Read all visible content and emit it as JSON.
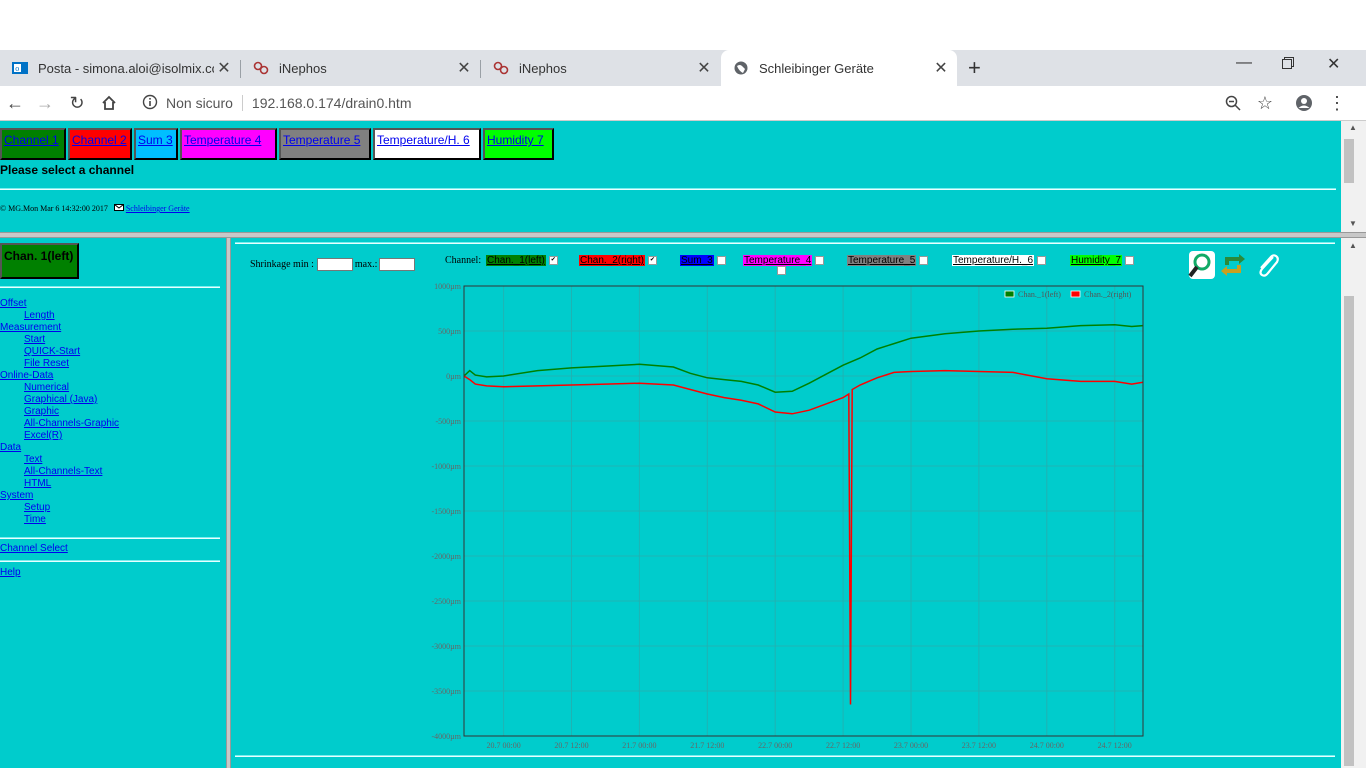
{
  "browser": {
    "tabs": [
      {
        "title": "Posta - simona.aloi@isolmix.com",
        "icon": "outlook-icon"
      },
      {
        "title": "iNephos",
        "icon": "inephos-icon"
      },
      {
        "title": "iNephos",
        "icon": "inephos-icon"
      },
      {
        "title": "Schleibinger Geräte",
        "icon": "globe-icon",
        "active": true
      }
    ],
    "security_label": "Non sicuro",
    "url": "192.168.0.174/drain0.htm"
  },
  "top": {
    "channels": [
      {
        "label": "Channel 1",
        "bg": "#008000",
        "fg": "#0000ee"
      },
      {
        "label": "Channel 2",
        "bg": "#ff0000",
        "fg": "#0000ee"
      },
      {
        "label": "Sum 3",
        "bg": "#00bfff",
        "fg": "#0000ee"
      },
      {
        "label": "Temperature 4",
        "bg": "#ff00ff",
        "fg": "#0000ee"
      },
      {
        "label": "Temperature 5",
        "bg": "#808080",
        "fg": "#0000ee"
      },
      {
        "label": "Temperature/H. 6",
        "bg": "#ffffff",
        "fg": "#0000ee"
      },
      {
        "label": "Humidity 7",
        "bg": "#00ff00",
        "fg": "#0000ee"
      }
    ],
    "prompt": "Please select a channel",
    "footer_text": "© MG.Mon Mar 6 14:32:00 2017",
    "footer_link": "Schleibinger Geräte"
  },
  "left": {
    "current_channel": "Chan. 1(left)",
    "menu": [
      {
        "label": "Offset",
        "level": 0
      },
      {
        "label": "Length",
        "level": 1
      },
      {
        "label": "Measurement",
        "level": 0
      },
      {
        "label": "Start",
        "level": 1
      },
      {
        "label": "QUICK-Start",
        "level": 1
      },
      {
        "label": "File Reset",
        "level": 1
      },
      {
        "label": "Online-Data",
        "level": 0
      },
      {
        "label": "Numerical",
        "level": 1
      },
      {
        "label": "Graphical (Java)",
        "level": 1
      },
      {
        "label": "Graphic",
        "level": 1
      },
      {
        "label": "All-Channels-Graphic",
        "level": 1
      },
      {
        "label": "Excel(R)",
        "level": 1
      },
      {
        "label": "Data",
        "level": 0
      },
      {
        "label": "Text",
        "level": 1
      },
      {
        "label": "All-Channels-Text",
        "level": 1
      },
      {
        "label": "HTML",
        "level": 1
      },
      {
        "label": "System",
        "level": 0
      },
      {
        "label": "Setup",
        "level": 1
      },
      {
        "label": "Time",
        "level": 1
      }
    ],
    "channel_select": "Channel Select",
    "help": "Help"
  },
  "main": {
    "shrinkage_min_label": "Shrinkage min :",
    "shrinkage_max_label": "max.:",
    "shrinkage_min_value": "",
    "shrinkage_max_value": "",
    "channel_label": "Channel:",
    "channel_checks": [
      {
        "label": "Chan._1(left)",
        "bg": "#008000",
        "fg": "#000000",
        "checked": true
      },
      {
        "label": "Chan._2(right)",
        "bg": "#ff0000",
        "fg": "#000000",
        "checked": true
      },
      {
        "label": "Sum_3",
        "bg": "#0000ff",
        "fg": "#000000",
        "checked": false
      },
      {
        "label": "Temperature_4",
        "bg": "#ff00ff",
        "fg": "#000000",
        "checked": false
      },
      {
        "label": "Temperature_5",
        "bg": "#808080",
        "fg": "#000000",
        "checked": false
      },
      {
        "label": "Temperature/H._6",
        "bg": "#ffffff",
        "fg": "#000000",
        "checked": false
      },
      {
        "label": "Humidity_7",
        "bg": "#00ff00",
        "fg": "#000000",
        "checked": false
      }
    ]
  },
  "chart_data": {
    "type": "line",
    "ylim": [
      -4000,
      1000
    ],
    "y_ticks": [
      1000,
      500,
      0,
      -500,
      -1000,
      -1500,
      -2000,
      -2500,
      -3000,
      -3500,
      -4000
    ],
    "y_tick_labels": [
      "1000µm",
      "500µm",
      "0µm",
      "-500µm",
      "-1000µm",
      "-1500µm",
      "-2000µm",
      "-2500µm",
      "-3000µm",
      "-3500µm",
      "-4000µm"
    ],
    "x_tick_labels": [
      "20.7 00:00",
      "20.7 12:00",
      "21.7 00:00",
      "21.7 12:00",
      "22.7 00:00",
      "22.7 12:00",
      "23.7 00:00",
      "23.7 12:00",
      "24.7 00:00",
      "24.7 12:00"
    ],
    "xlim_hours": [
      -7,
      113
    ],
    "grid": true,
    "legend_position": "top-right",
    "series": [
      {
        "name": "Chan._1(left)",
        "color": "#008000",
        "x_hours": [
          -7,
          -6,
          -5,
          -3,
          0,
          6,
          12,
          18,
          24,
          30,
          33,
          36,
          39,
          42,
          45,
          48,
          51,
          54,
          57,
          60,
          63,
          66,
          69,
          72,
          78,
          84,
          90,
          96,
          102,
          108,
          111,
          113
        ],
        "y": [
          0,
          60,
          10,
          -10,
          0,
          60,
          90,
          110,
          130,
          100,
          30,
          -20,
          -40,
          -60,
          -100,
          -180,
          -170,
          -80,
          20,
          120,
          200,
          300,
          360,
          420,
          470,
          500,
          520,
          530,
          560,
          570,
          550,
          560
        ]
      },
      {
        "name": "Chan._2(right)",
        "color": "#ff0000",
        "x_hours": [
          -7,
          -6,
          -5,
          -3,
          0,
          6,
          12,
          18,
          24,
          30,
          33,
          36,
          39,
          42,
          45,
          48,
          51,
          54,
          57,
          60,
          61,
          61.3,
          61.6,
          63,
          66,
          69,
          72,
          78,
          84,
          90,
          96,
          102,
          108,
          111,
          113
        ],
        "y": [
          0,
          -40,
          -90,
          -110,
          -120,
          -110,
          -100,
          -90,
          -80,
          -100,
          -150,
          -200,
          -240,
          -270,
          -310,
          -400,
          -420,
          -380,
          -310,
          -240,
          -200,
          -3650,
          -150,
          -100,
          -20,
          40,
          50,
          60,
          50,
          40,
          -30,
          -60,
          -60,
          -90,
          -70
        ]
      }
    ]
  }
}
